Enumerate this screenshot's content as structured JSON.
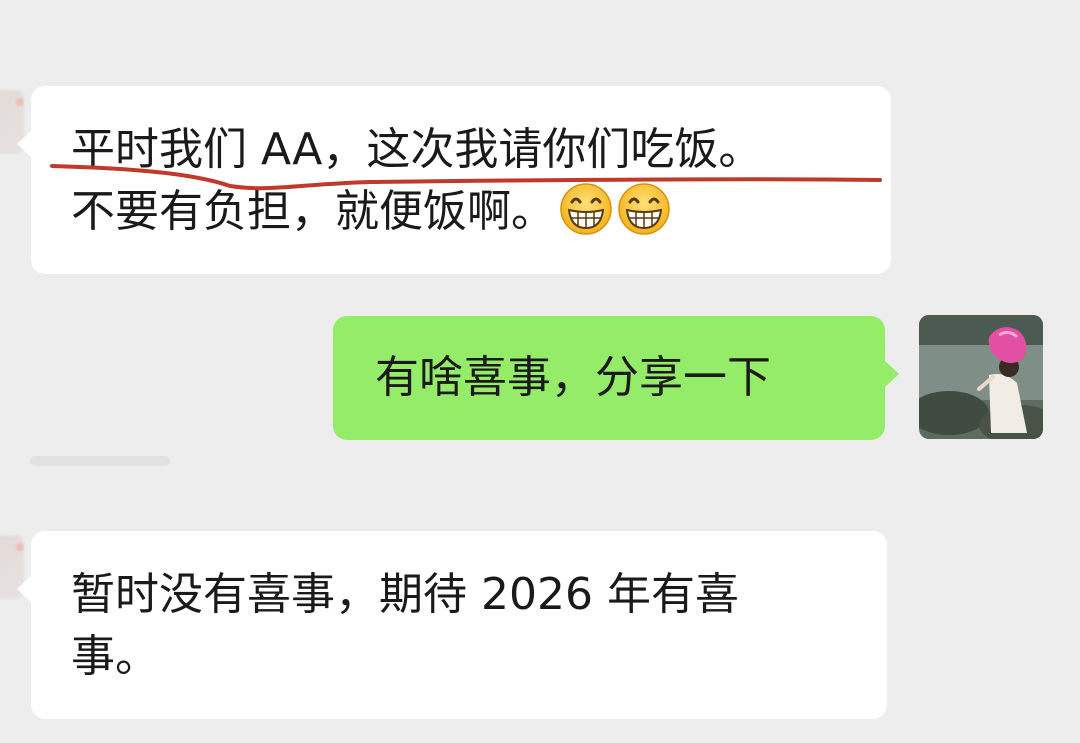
{
  "messages": [
    {
      "side": "left",
      "lines": [
        "平时我们 AA，这次我请你们吃饭。",
        "不要有负担，就便饭啊。"
      ],
      "emojis": [
        "grin-emoji",
        "grin-emoji"
      ]
    },
    {
      "side": "right",
      "lines": [
        "有啥喜事，分享一下"
      ]
    },
    {
      "side": "left",
      "lines": [
        "暂时没有喜事，期待 2026 年有喜",
        "事。"
      ]
    }
  ],
  "colors": {
    "background": "#ededed",
    "incoming_bubble": "#ffffff",
    "outgoing_bubble": "#95ec69",
    "underline": "#c0392b",
    "text": "#1a1a1a"
  }
}
